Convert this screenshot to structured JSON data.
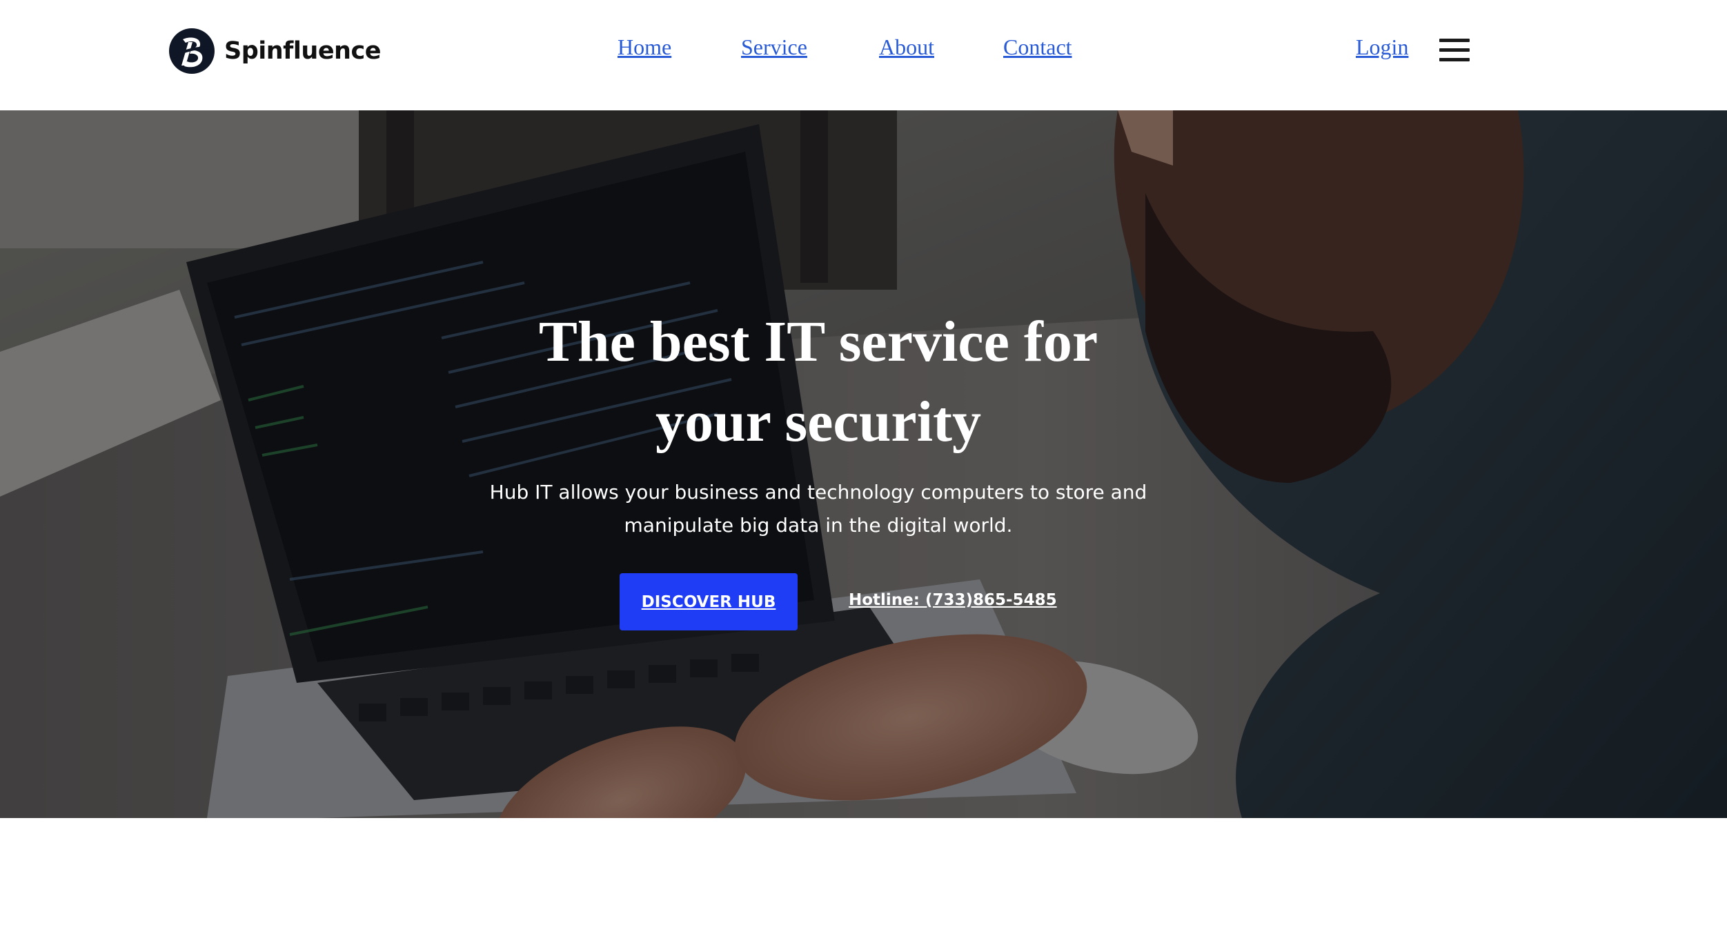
{
  "header": {
    "brand_name": "Spinfluence",
    "nav": {
      "home": "Home",
      "service": "Service",
      "about": "About",
      "contact": "Contact"
    },
    "login": "Login",
    "menu_icon": "hamburger-menu-icon"
  },
  "hero": {
    "title_line1": "The best IT service for",
    "title_line2": "your security",
    "subtitle_line1": "Hub IT allows your business and technology computers to store and",
    "subtitle_line2": "manipulate big data in the digital world.",
    "cta_label": "DISCOVER HUB",
    "hotline": "Hotline: (733)865-5485",
    "background_image": "person-typing-on-laptop-photo"
  },
  "colors": {
    "link": "#2a5bd7",
    "cta": "#1f3df5",
    "brand_text": "#111111"
  }
}
